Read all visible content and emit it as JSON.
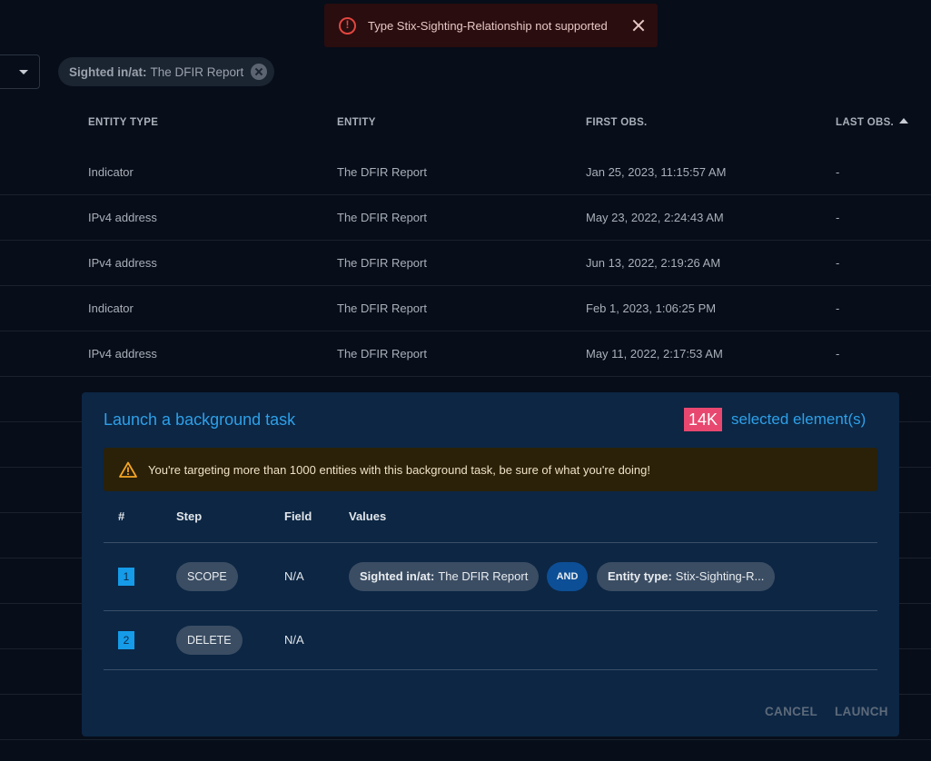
{
  "toast": {
    "message": "Type Stix-Sighting-Relationship not supported"
  },
  "filter": {
    "key": "Sighted in/at:",
    "value": "The DFIR Report"
  },
  "table": {
    "headers": [
      "ENTITY TYPE",
      "ENTITY",
      "FIRST OBS.",
      "LAST OBS."
    ],
    "rows": [
      [
        "Indicator",
        "The DFIR Report",
        "Jan 25, 2023, 11:15:57 AM",
        "-"
      ],
      [
        "IPv4 address",
        "The DFIR Report",
        "May 23, 2022, 2:24:43 AM",
        "-"
      ],
      [
        "IPv4 address",
        "The DFIR Report",
        "Jun 13, 2022, 2:19:26 AM",
        "-"
      ],
      [
        "Indicator",
        "The DFIR Report",
        "Feb 1, 2023, 1:06:25 PM",
        "-"
      ],
      [
        "IPv4 address",
        "The DFIR Report",
        "May 11, 2022, 2:17:53 AM",
        "-"
      ]
    ]
  },
  "dialog": {
    "title": "Launch a background task",
    "count": "14K",
    "count_label": "selected element(s)",
    "warning": "You're targeting more than 1000 entities with this background task, be sure of what you're doing!",
    "columns": {
      "num": "#",
      "step": "Step",
      "field": "Field",
      "values": "Values"
    },
    "steps": [
      {
        "num": "1",
        "step": "SCOPE",
        "field": "N/A",
        "values": [
          {
            "key": "Sighted in/at:",
            "value": "The DFIR Report"
          },
          {
            "operator": "AND"
          },
          {
            "key": "Entity type:",
            "value": "Stix-Sighting-R..."
          }
        ]
      },
      {
        "num": "2",
        "step": "DELETE",
        "field": "N/A"
      }
    ],
    "cancel": "CANCEL",
    "launch": "LAUNCH"
  },
  "colors": {
    "accent": "#2ea0e8",
    "badge": "#e8486f",
    "error": "#e2463e",
    "warning": "#f5a623"
  }
}
